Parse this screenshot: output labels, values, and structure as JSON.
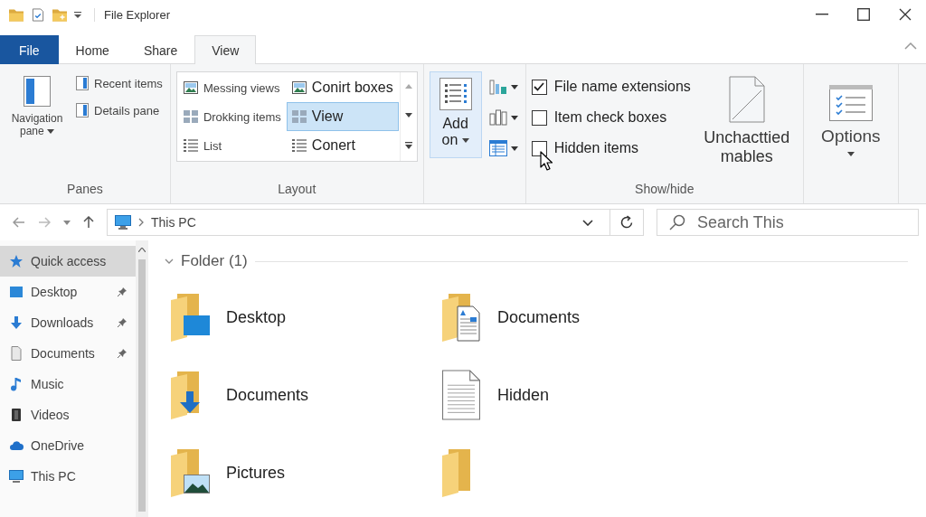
{
  "window": {
    "title": "File Explorer"
  },
  "tabs": [
    {
      "label": "File",
      "kind": "menu",
      "selected": false
    },
    {
      "label": "Home",
      "kind": "tab",
      "selected": false
    },
    {
      "label": "Share",
      "kind": "tab",
      "selected": false
    },
    {
      "label": "View",
      "kind": "tab",
      "selected": true
    }
  ],
  "ribbon": {
    "panes": {
      "label": "Panes",
      "main": "Navigation pane",
      "buttons": [
        "Recent items",
        "Details pane"
      ]
    },
    "layout": {
      "label": "Layout",
      "items": [
        {
          "label": "Messing views",
          "kind": "pictures",
          "selected": false
        },
        {
          "label": "Conirt boxes",
          "kind": "pictures",
          "selected": false
        },
        {
          "label": "Drokking items",
          "kind": "tiles",
          "selected": false
        },
        {
          "label": "View",
          "kind": "tiles",
          "selected": true
        },
        {
          "label": "List",
          "kind": "list",
          "selected": false
        },
        {
          "label": "Conert",
          "kind": "list",
          "selected": false
        }
      ]
    },
    "current_view": {
      "button": {
        "label": "Add on",
        "selected": true
      }
    },
    "show_hide": {
      "label": "Show/hide",
      "checkboxes": [
        {
          "label": "File name extensions",
          "checked": true
        },
        {
          "label": "Item check boxes",
          "checked": false
        },
        {
          "label": "Hidden items",
          "checked": false
        }
      ],
      "button": "Unchacttied mables"
    },
    "options": {
      "label": "Options"
    }
  },
  "address_bar": {
    "path": "This PC"
  },
  "search": {
    "placeholder": "Search This"
  },
  "sidebar": {
    "items": [
      {
        "label": "Quick access",
        "kind": "quick",
        "selected": true,
        "pinned": false
      },
      {
        "label": "Desktop",
        "kind": "desktop",
        "selected": false,
        "pinned": true
      },
      {
        "label": "Downloads",
        "kind": "download",
        "selected": false,
        "pinned": true
      },
      {
        "label": "Documents",
        "kind": "documents",
        "selected": false,
        "pinned": true
      },
      {
        "label": "Music",
        "kind": "music",
        "selected": false,
        "pinned": false
      },
      {
        "label": "Videos",
        "kind": "videos",
        "selected": false,
        "pinned": false
      },
      {
        "label": "OneDrive",
        "kind": "cloud",
        "selected": false,
        "pinned": false
      },
      {
        "label": "This PC",
        "kind": "pc",
        "selected": false,
        "pinned": false
      }
    ]
  },
  "content": {
    "group": "Folder (1)",
    "items": [
      {
        "name": "Desktop",
        "kind": "desktop"
      },
      {
        "name": "Documents",
        "kind": "download"
      },
      {
        "name": "Pictures",
        "kind": "pictures"
      },
      {
        "name": "Documents",
        "kind": "documents"
      },
      {
        "name": "Hidden",
        "kind": "file"
      },
      {
        "kind": "folder"
      }
    ]
  }
}
